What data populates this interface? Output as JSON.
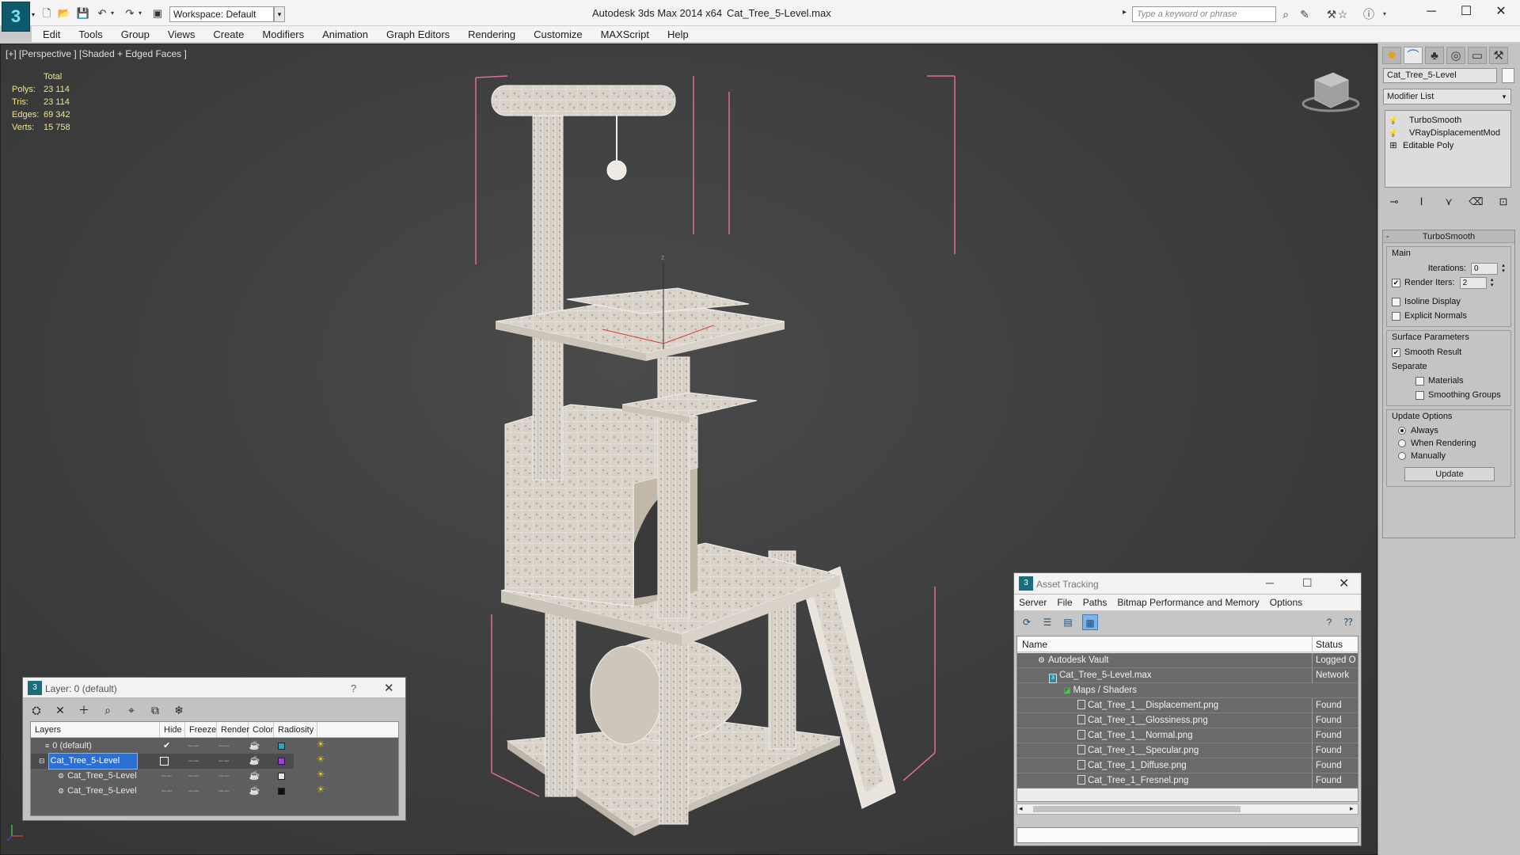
{
  "titlebar": {
    "workspace": "Workspace: Default",
    "app_title": "Autodesk 3ds Max  2014 x64",
    "file_title": "Cat_Tree_5-Level.max",
    "search_placeholder": "Type a keyword or phrase"
  },
  "menu": [
    "Edit",
    "Tools",
    "Group",
    "Views",
    "Create",
    "Modifiers",
    "Animation",
    "Graph Editors",
    "Rendering",
    "Customize",
    "MAXScript",
    "Help"
  ],
  "viewport": {
    "label": "[+] [Perspective ] [Shaded + Edged Faces ]",
    "stats": {
      "header": "Total",
      "rows": [
        {
          "label": "Polys:",
          "value": "23 114"
        },
        {
          "label": "Tris:",
          "value": "23 114"
        },
        {
          "label": "Edges:",
          "value": "69 342"
        },
        {
          "label": "Verts:",
          "value": "15 758"
        }
      ]
    },
    "axis_z": "z"
  },
  "command_panel": {
    "object_name": "Cat_Tree_5-Level",
    "modifier_list": "Modifier List",
    "stack": [
      "TurboSmooth",
      "VRayDisplacementMod",
      "Editable Poly"
    ],
    "rollout_title": "TurboSmooth",
    "main_group": "Main",
    "iterations_label": "Iterations:",
    "iterations_value": "0",
    "render_iters_label": "Render Iters:",
    "render_iters_value": "2",
    "isoline_label": "Isoline Display",
    "explicit_normals_label": "Explicit Normals",
    "surface_group": "Surface Parameters",
    "smooth_result_label": "Smooth Result",
    "separate_label": "Separate",
    "materials_label": "Materials",
    "smoothing_groups_label": "Smoothing Groups",
    "update_group": "Update Options",
    "always_label": "Always",
    "when_rendering_label": "When Rendering",
    "manually_label": "Manually",
    "update_button": "Update"
  },
  "layer_dialog": {
    "title": "Layer: 0 (default)",
    "help": "?",
    "columns": [
      "Layers",
      "Hide",
      "Freeze",
      "Render",
      "Color",
      "Radiosity"
    ],
    "rows": [
      {
        "name": "0 (default)",
        "color": "#2aa6c4"
      },
      {
        "name": "Cat_Tree_5-Level",
        "color": "#9a45d8"
      },
      {
        "name": "Cat_Tree_5-Level",
        "color": "#e6e6e6"
      },
      {
        "name": "Cat_Tree_5-Level",
        "color": "#111111"
      }
    ]
  },
  "asset_dialog": {
    "title": "Asset Tracking",
    "menu": [
      "Server",
      "File",
      "Paths",
      "Bitmap Performance and Memory",
      "Options"
    ],
    "col_name": "Name",
    "col_status": "Status",
    "rows": [
      {
        "name": "Autodesk Vault",
        "status": "Logged Out"
      },
      {
        "name": "Cat_Tree_5-Level.max",
        "status": "Network"
      },
      {
        "name": "Maps / Shaders",
        "status": ""
      },
      {
        "name": "Cat_Tree_1__Displacement.png",
        "status": "Found"
      },
      {
        "name": "Cat_Tree_1__Glossiness.png",
        "status": "Found"
      },
      {
        "name": "Cat_Tree_1__Normal.png",
        "status": "Found"
      },
      {
        "name": "Cat_Tree_1__Specular.png",
        "status": "Found"
      },
      {
        "name": "Cat_Tree_1_Diffuse.png",
        "status": "Found"
      },
      {
        "name": "Cat_Tree_1_Fresnel.png",
        "status": "Found"
      }
    ]
  }
}
